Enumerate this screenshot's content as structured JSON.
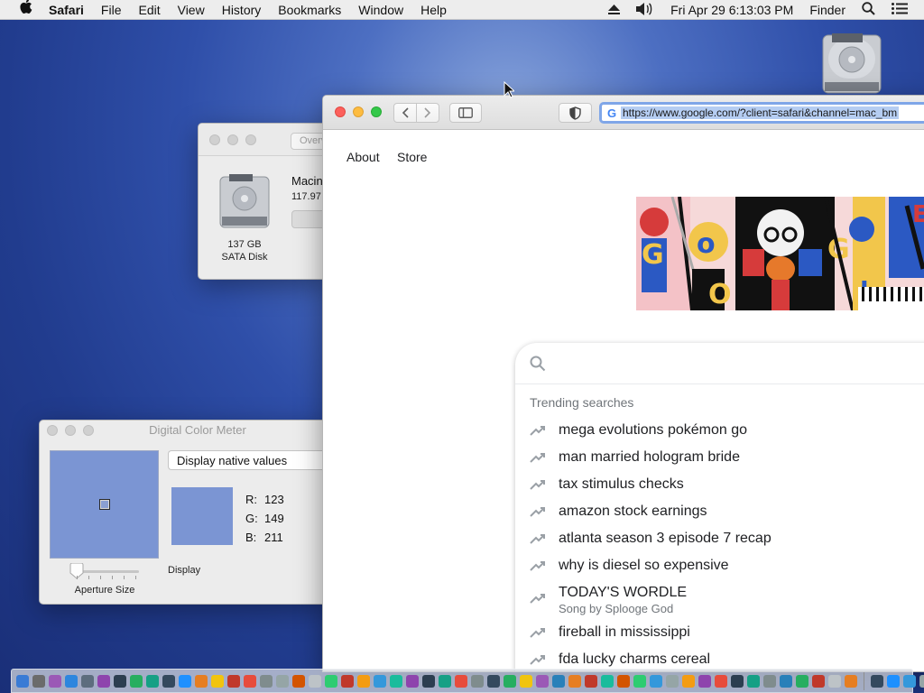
{
  "menubar": {
    "app_name": "Safari",
    "menus": [
      "File",
      "Edit",
      "View",
      "History",
      "Bookmarks",
      "Window",
      "Help"
    ],
    "clock": "Fri Apr 29  6:13:03 PM",
    "finder_label": "Finder",
    "icons": [
      "apple-icon",
      "eject-icon",
      "volume-icon",
      "spotlight-icon",
      "notification-center-icon"
    ]
  },
  "disk_window": {
    "tab_label": "Overview",
    "disk_size": "137 GB",
    "disk_type": "SATA Disk",
    "volume_name": "Macin",
    "capacity": "117.97"
  },
  "color_meter": {
    "title": "Digital Color Meter",
    "mode": "Display native values",
    "r_label": "R:",
    "g_label": "G:",
    "b_label": "B:",
    "r": "123",
    "g": "149",
    "b": "211",
    "swatch_color": "#7b95d3",
    "display_label": "Display",
    "aperture_label": "Aperture Size"
  },
  "safari": {
    "url": "https://www.google.com/?client=safari&channel=mac_bm",
    "links": [
      "About",
      "Store"
    ],
    "trending_header": "Trending searches",
    "trending": [
      {
        "query": "mega evolutions pokémon go",
        "sub": ""
      },
      {
        "query": "man married hologram bride",
        "sub": ""
      },
      {
        "query": "tax stimulus checks",
        "sub": ""
      },
      {
        "query": "amazon stock earnings",
        "sub": ""
      },
      {
        "query": "atlanta season 3 episode 7 recap",
        "sub": ""
      },
      {
        "query": "why is diesel so expensive",
        "sub": ""
      },
      {
        "query": "TODAY'S WORDLE",
        "sub": "Song by Splooge God"
      },
      {
        "query": "fireball in mississippi",
        "sub": ""
      },
      {
        "query": "fda lucky charms cereal",
        "sub": ""
      }
    ]
  },
  "dock": {
    "colors": [
      "#3a7bd5",
      "#6b6b6b",
      "#9b59b6",
      "#2e86de",
      "#5d6d7e",
      "#8e44ad",
      "#2c3e50",
      "#27ae60",
      "#16a085",
      "#34495e",
      "#1e90ff",
      "#e67e22",
      "#f1c40f",
      "#c0392b",
      "#e74c3c",
      "#7f8c8d",
      "#95a5a6",
      "#d35400",
      "#bdc3c7",
      "#2ecc71",
      "#c0392b",
      "#f39c12",
      "#3498db",
      "#1abc9c",
      "#8e44ad",
      "#2c3e50",
      "#16a085",
      "#e74c3c",
      "#7f8c8d",
      "#34495e",
      "#27ae60",
      "#f1c40f",
      "#9b59b6",
      "#2980b9",
      "#e67e22",
      "#c0392b",
      "#1abc9c",
      "#d35400",
      "#2ecc71",
      "#3498db",
      "#95a5a6",
      "#f39c12",
      "#8e44ad",
      "#e74c3c",
      "#2c3e50",
      "#16a085",
      "#7f8c8d",
      "#2980b9",
      "#27ae60",
      "#c0392b",
      "#bdc3c7",
      "#e67e22",
      "#34495e",
      "#1e90ff",
      "#3498db",
      "#95a5a6"
    ]
  }
}
